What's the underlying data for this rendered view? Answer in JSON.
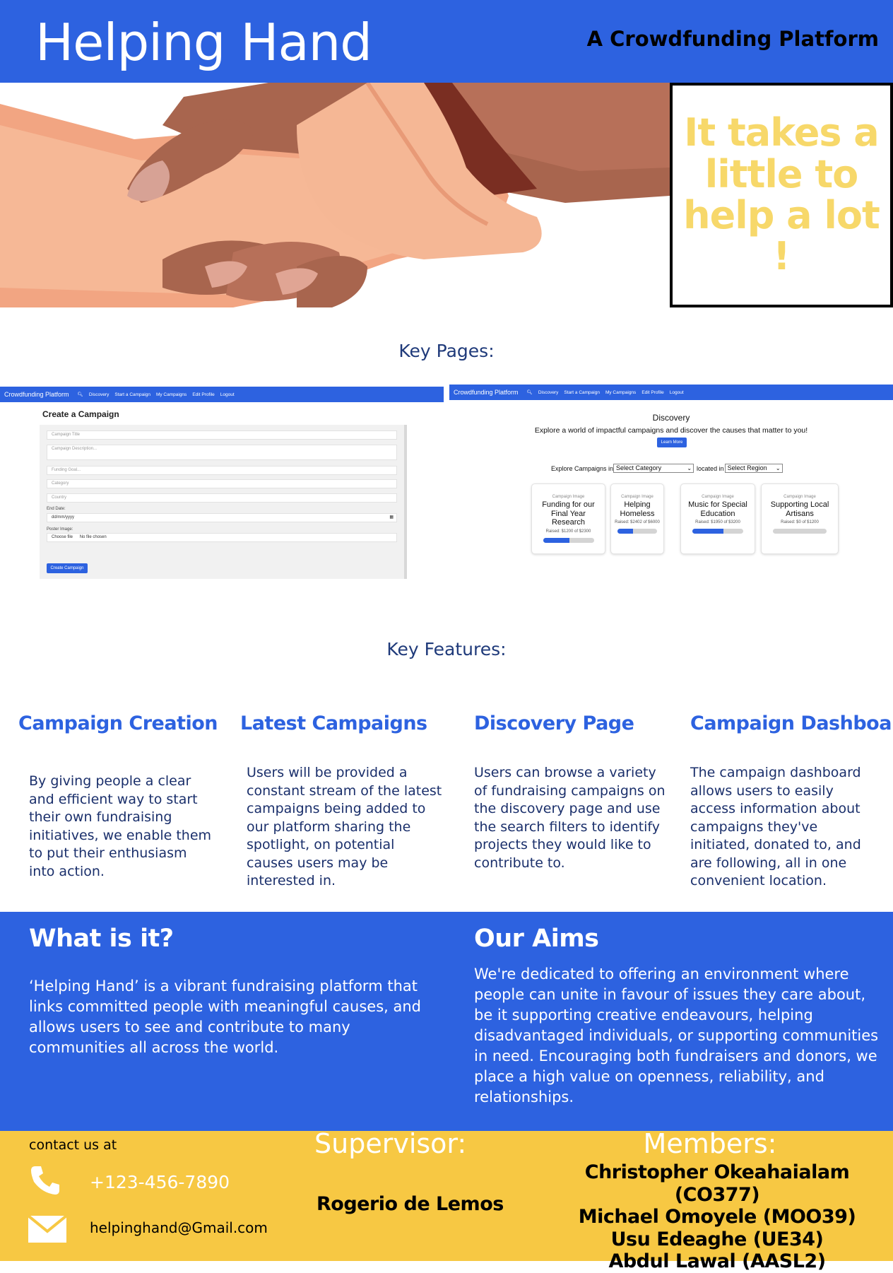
{
  "header": {
    "title": "Helping Hand",
    "tagline": "A Crowdfunding Platform"
  },
  "hero": {
    "image": "handshake-illustration",
    "slogan": "It takes a little to help a lot !"
  },
  "key_pages": {
    "heading": "Key Pages:",
    "create_mock": {
      "nav": {
        "brand": "Crowdfunding Platform",
        "items": [
          "Discovery",
          "Start a Campaign",
          "My Campaigns",
          "Edit Profile",
          "Logout"
        ]
      },
      "title": "Create a Campaign",
      "placeholders": [
        "Campaign Title",
        "Campaign Description...",
        "Funding Goal...",
        "Category",
        "Country"
      ],
      "end_date_label": "End Date:",
      "end_date_value": "dd/mm/yyyy",
      "poster_label": "Poster Image:",
      "choose_file": "Choose file",
      "no_file": "No file chosen",
      "submit": "Create Campaign"
    },
    "discovery_mock": {
      "nav": {
        "brand": "Crowdfunding Platform",
        "items": [
          "Discovery",
          "Start a Campaign",
          "My Campaigns",
          "Edit Profile",
          "Logout"
        ]
      },
      "title": "Discovery",
      "subtitle": "Explore a world of impactful campaigns and discover the causes that matter to you!",
      "learn_more": "Learn More",
      "explore_label": "Explore Campaigns in",
      "category_select": "Select Category",
      "located_label": "located in",
      "region_select": "Select Region",
      "cards": [
        {
          "image_alt": "Campaign Image",
          "title": "Funding for our Final Year Research",
          "raised": "Raised: $1200 of $2300",
          "progress": 0.52
        },
        {
          "image_alt": "Campaign Image",
          "title": "Helping Homeless",
          "raised": "Raised: $2402 of $6000",
          "progress": 0.4
        },
        {
          "image_alt": "Campaign Image",
          "title": "Music for Special Education",
          "raised": "Raised: $1950 of $3200",
          "progress": 0.61
        },
        {
          "image_alt": "Campaign Image",
          "title": "Supporting Local Artisans",
          "raised": "Raised: $0 of $1200",
          "progress": 0
        }
      ]
    }
  },
  "key_features": {
    "heading": "Key Features:",
    "items": [
      {
        "title": "Campaign Creation",
        "desc": "By giving people a clear and efficient way to start their own fundraising initiatives, we enable them to put their enthusiasm into action."
      },
      {
        "title": "Latest Campaigns",
        "desc": "Users will be provided a constant stream of the latest campaigns being added to our platform sharing the spotlight, on potential causes users may be interested in."
      },
      {
        "title": "Discovery Page",
        "desc": "Users can browse a variety of fundraising campaigns on the discovery page and use the search filters to identify projects they would like to contribute to."
      },
      {
        "title": "Campaign Dashboard",
        "desc": "The campaign dashboard allows users to easily access information about campaigns they've initiated, donated to, and are following, all in one convenient location."
      }
    ]
  },
  "about": {
    "what_title": "What is it?",
    "what_text": "‘Helping Hand’ is a vibrant fundraising platform that links committed people with meaningful causes, and allows users to see and contribute to many communities all across the world.",
    "aims_title": "Our Aims",
    "aims_text": "We're dedicated to offering an environment where people can unite in favour of issues they care about, be it supporting creative endeavours, helping disadvantaged individuals, or supporting communities in need. Encouraging both fundraisers and donors, we place a high value on openness, reliability, and relationships."
  },
  "footer": {
    "contact_label": "contact us at",
    "phone": "+123-456-7890",
    "email": "helpinghand@Gmail.com",
    "supervisor_label": "Supervisor:",
    "supervisor": "Rogerio de Lemos",
    "members_label": "Members:",
    "members": [
      "Christopher Okeahaialam (CO377)",
      "Michael Omoyele (MOO39)",
      "Usu Edeaghe (UE34)",
      "Abdul Lawal (AASL2)"
    ]
  },
  "colors": {
    "brand_blue": "#2d62e0",
    "slogan_yellow": "#f7d86a",
    "footer_yellow": "#f7c843",
    "heading_navy": "#1f3a7a"
  }
}
